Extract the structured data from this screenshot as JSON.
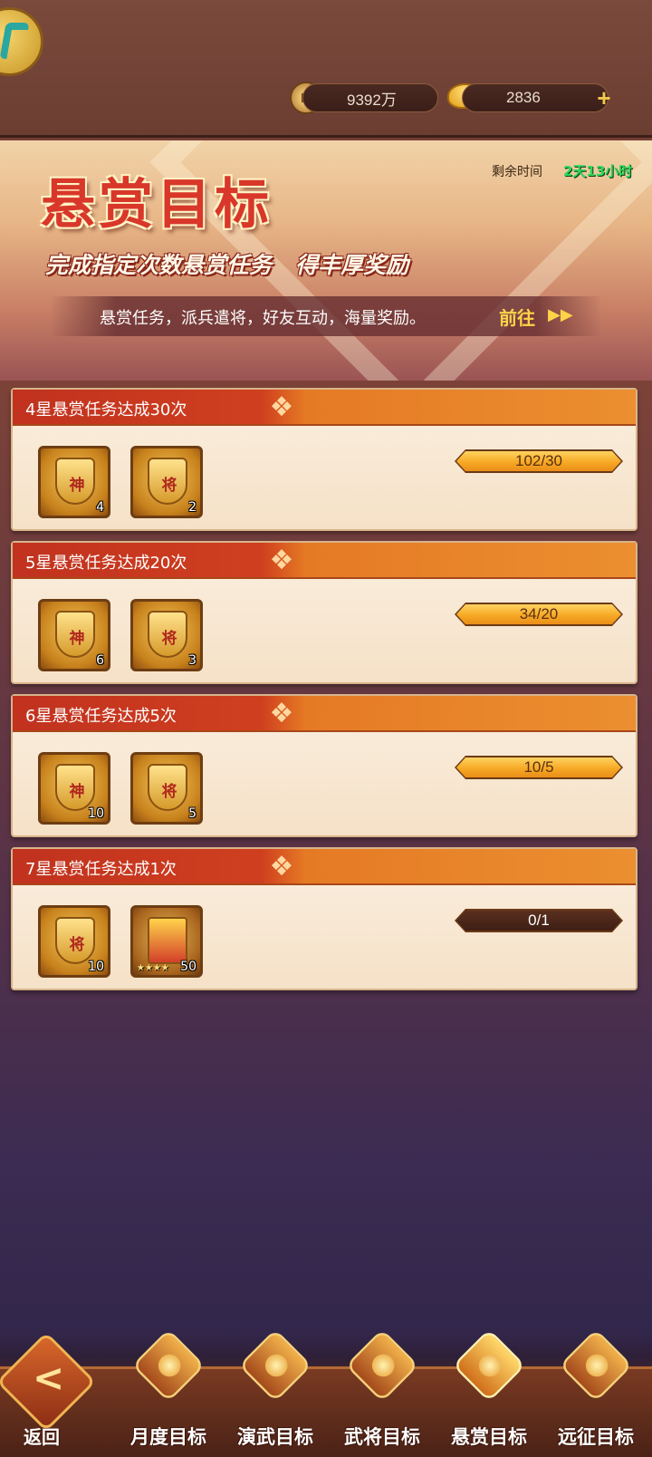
{
  "resources": {
    "coins": "9392万",
    "ingots": "2836",
    "add_label": "+"
  },
  "banner": {
    "title": "悬赏目标",
    "subtitle": "完成指定次数悬赏任务   得丰厚奖励",
    "remaining_label": "剩余时间",
    "remaining_value": "2天13小时",
    "info_text": "悬赏任务，派兵遣将，好友互动，海量奖励。",
    "goto_label": "前往",
    "goto_arrow": "▶▶"
  },
  "tasks": [
    {
      "title": "4星悬赏任务达成30次",
      "progress_text": "102/30",
      "progress_fraction": 1.0,
      "rewards": [
        {
          "icon": "divine-token-icon",
          "char": "神",
          "count": "4"
        },
        {
          "icon": "general-token-icon",
          "char": "将",
          "count": "2"
        }
      ]
    },
    {
      "title": "5星悬赏任务达成20次",
      "progress_text": "34/20",
      "progress_fraction": 1.0,
      "rewards": [
        {
          "icon": "divine-token-icon",
          "char": "神",
          "count": "6"
        },
        {
          "icon": "general-token-icon",
          "char": "将",
          "count": "3"
        }
      ]
    },
    {
      "title": "6星悬赏任务达成5次",
      "progress_text": "10/5",
      "progress_fraction": 1.0,
      "rewards": [
        {
          "icon": "divine-token-icon",
          "char": "神",
          "count": "10"
        },
        {
          "icon": "general-token-icon",
          "char": "将",
          "count": "5"
        }
      ]
    },
    {
      "title": "7星悬赏任务达成1次",
      "progress_text": "0/1",
      "progress_fraction": 0.0,
      "rewards": [
        {
          "icon": "general-token-icon",
          "char": "将",
          "count": "10"
        },
        {
          "icon": "hero-shard-icon",
          "stars": "★★★★",
          "count": "50"
        }
      ]
    }
  ],
  "bottom_nav": {
    "back_label": "返回",
    "back_arrow": "<",
    "items": [
      {
        "label": "月度目标",
        "icon": "monthly-goal-icon",
        "active": false
      },
      {
        "label": "演武目标",
        "icon": "drum-icon",
        "active": false
      },
      {
        "label": "武将目标",
        "icon": "general-goal-icon",
        "active": false
      },
      {
        "label": "悬赏目标",
        "icon": "trophy-icon",
        "active": true
      },
      {
        "label": "远征目标",
        "icon": "expedition-shield-icon",
        "active": false
      }
    ]
  },
  "colors": {
    "accent_red": "#d8372a",
    "timer_green": "#2dd85c",
    "progress_gold": "#f7a925"
  }
}
